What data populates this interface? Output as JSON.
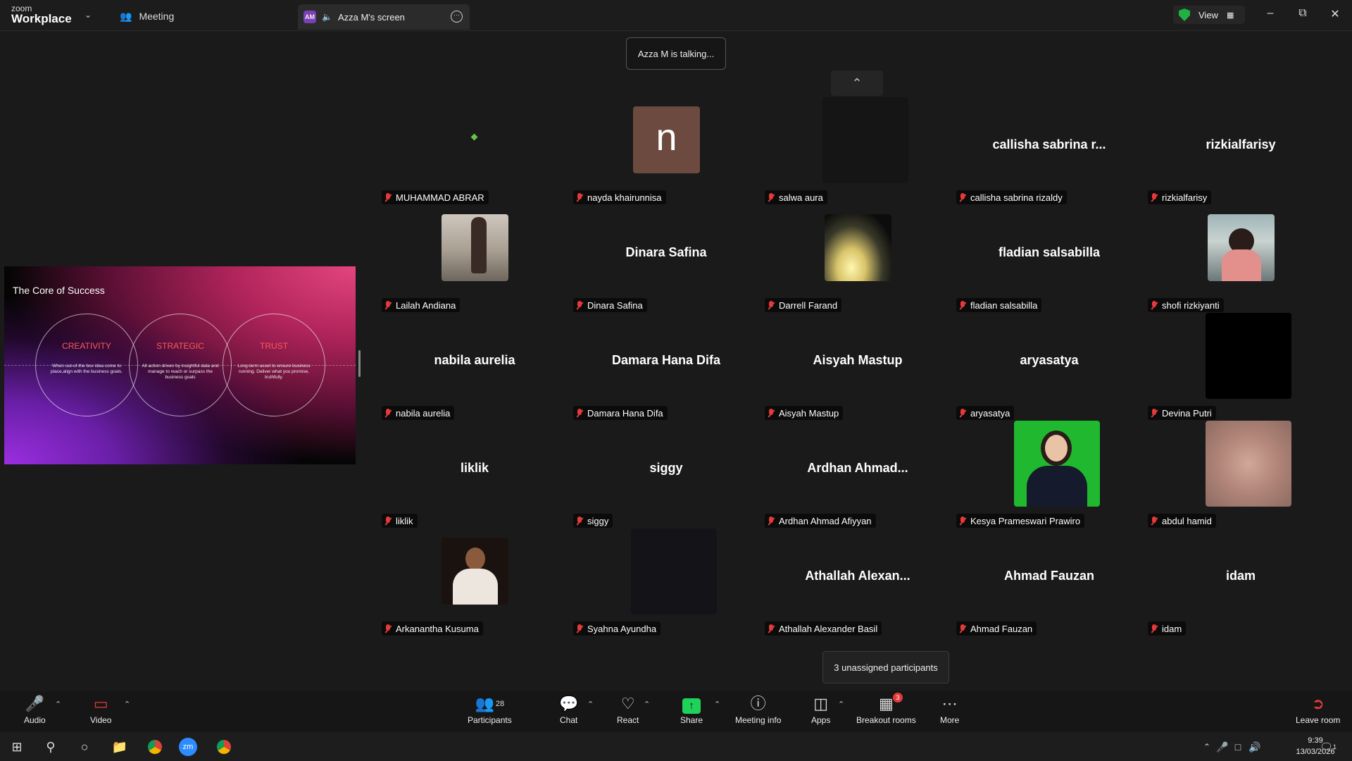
{
  "app": {
    "logo_top": "zoom",
    "logo_bottom": "Workplace",
    "meeting_tab": "Meeting",
    "screen_tab": "Azza M's screen",
    "screen_tab_avatar": "AM",
    "view_label": "View"
  },
  "talking": "Azza M is talking...",
  "slide": {
    "title": "The Core of Success",
    "items": [
      {
        "title": "CREATIVITY",
        "desc": "When out-of-the box idea come to place,align with the business goals."
      },
      {
        "title": "STRATEGIC",
        "desc": "All action driven by insightful data and manage to reach or surpass the business goals"
      },
      {
        "title": "TRUST",
        "desc": "Long-term asset to ensure business running. Deliver what you promise, truthfully."
      }
    ]
  },
  "participants": [
    {
      "name": "MUHAMMAD ABRAR",
      "display": ""
    },
    {
      "name": "nayda khairunnisa",
      "display": "n"
    },
    {
      "name": "salwa aura",
      "display": ""
    },
    {
      "name": "callisha sabrina rizaldy",
      "display": "callisha sabrina r..."
    },
    {
      "name": "rizkialfarisy",
      "display": "rizkialfarisy"
    },
    {
      "name": "Lailah Andiana",
      "display": ""
    },
    {
      "name": "Dinara Safina",
      "display": "Dinara Safina"
    },
    {
      "name": "Darrell Farand",
      "display": ""
    },
    {
      "name": "fladian salsabilla",
      "display": "fladian salsabilla"
    },
    {
      "name": "shofi rizkiyanti",
      "display": ""
    },
    {
      "name": "nabila aurelia",
      "display": "nabila aurelia"
    },
    {
      "name": "Damara Hana Difa",
      "display": "Damara Hana Difa"
    },
    {
      "name": "Aisyah Mastup",
      "display": "Aisyah Mastup"
    },
    {
      "name": "aryasatya",
      "display": "aryasatya"
    },
    {
      "name": "Devina Putri",
      "display": ""
    },
    {
      "name": "liklik",
      "display": "liklik"
    },
    {
      "name": "siggy",
      "display": "siggy"
    },
    {
      "name": "Ardhan Ahmad Afiyyan",
      "display": "Ardhan  Ahmad..."
    },
    {
      "name": "Kesya Prameswari Prawiro",
      "display": ""
    },
    {
      "name": "abdul hamid",
      "display": ""
    },
    {
      "name": "Arkanantha Kusuma",
      "display": ""
    },
    {
      "name": "Syahna Ayundha",
      "display": ""
    },
    {
      "name": "Athallah Alexander Basil",
      "display": "Athallah  Alexan..."
    },
    {
      "name": "Ahmad Fauzan",
      "display": "Ahmad Fauzan"
    },
    {
      "name": "idam",
      "display": "idam"
    }
  ],
  "unassigned": "3 unassigned participants",
  "toolbar": {
    "audio": "Audio",
    "video": "Video",
    "participants": "Participants",
    "participants_count": "28",
    "chat": "Chat",
    "react": "React",
    "share": "Share",
    "meeting_info": "Meeting info",
    "apps": "Apps",
    "breakout": "Breakout rooms",
    "breakout_badge": "3",
    "more": "More",
    "leave": "Leave room"
  },
  "taskbar": {
    "time": "9:39",
    "date": "13/03/2026",
    "notif_count": "1"
  },
  "colors": {
    "accent_green": "#1fd25a",
    "mute_red": "#e53a3a",
    "bg": "#1a1a1a"
  }
}
